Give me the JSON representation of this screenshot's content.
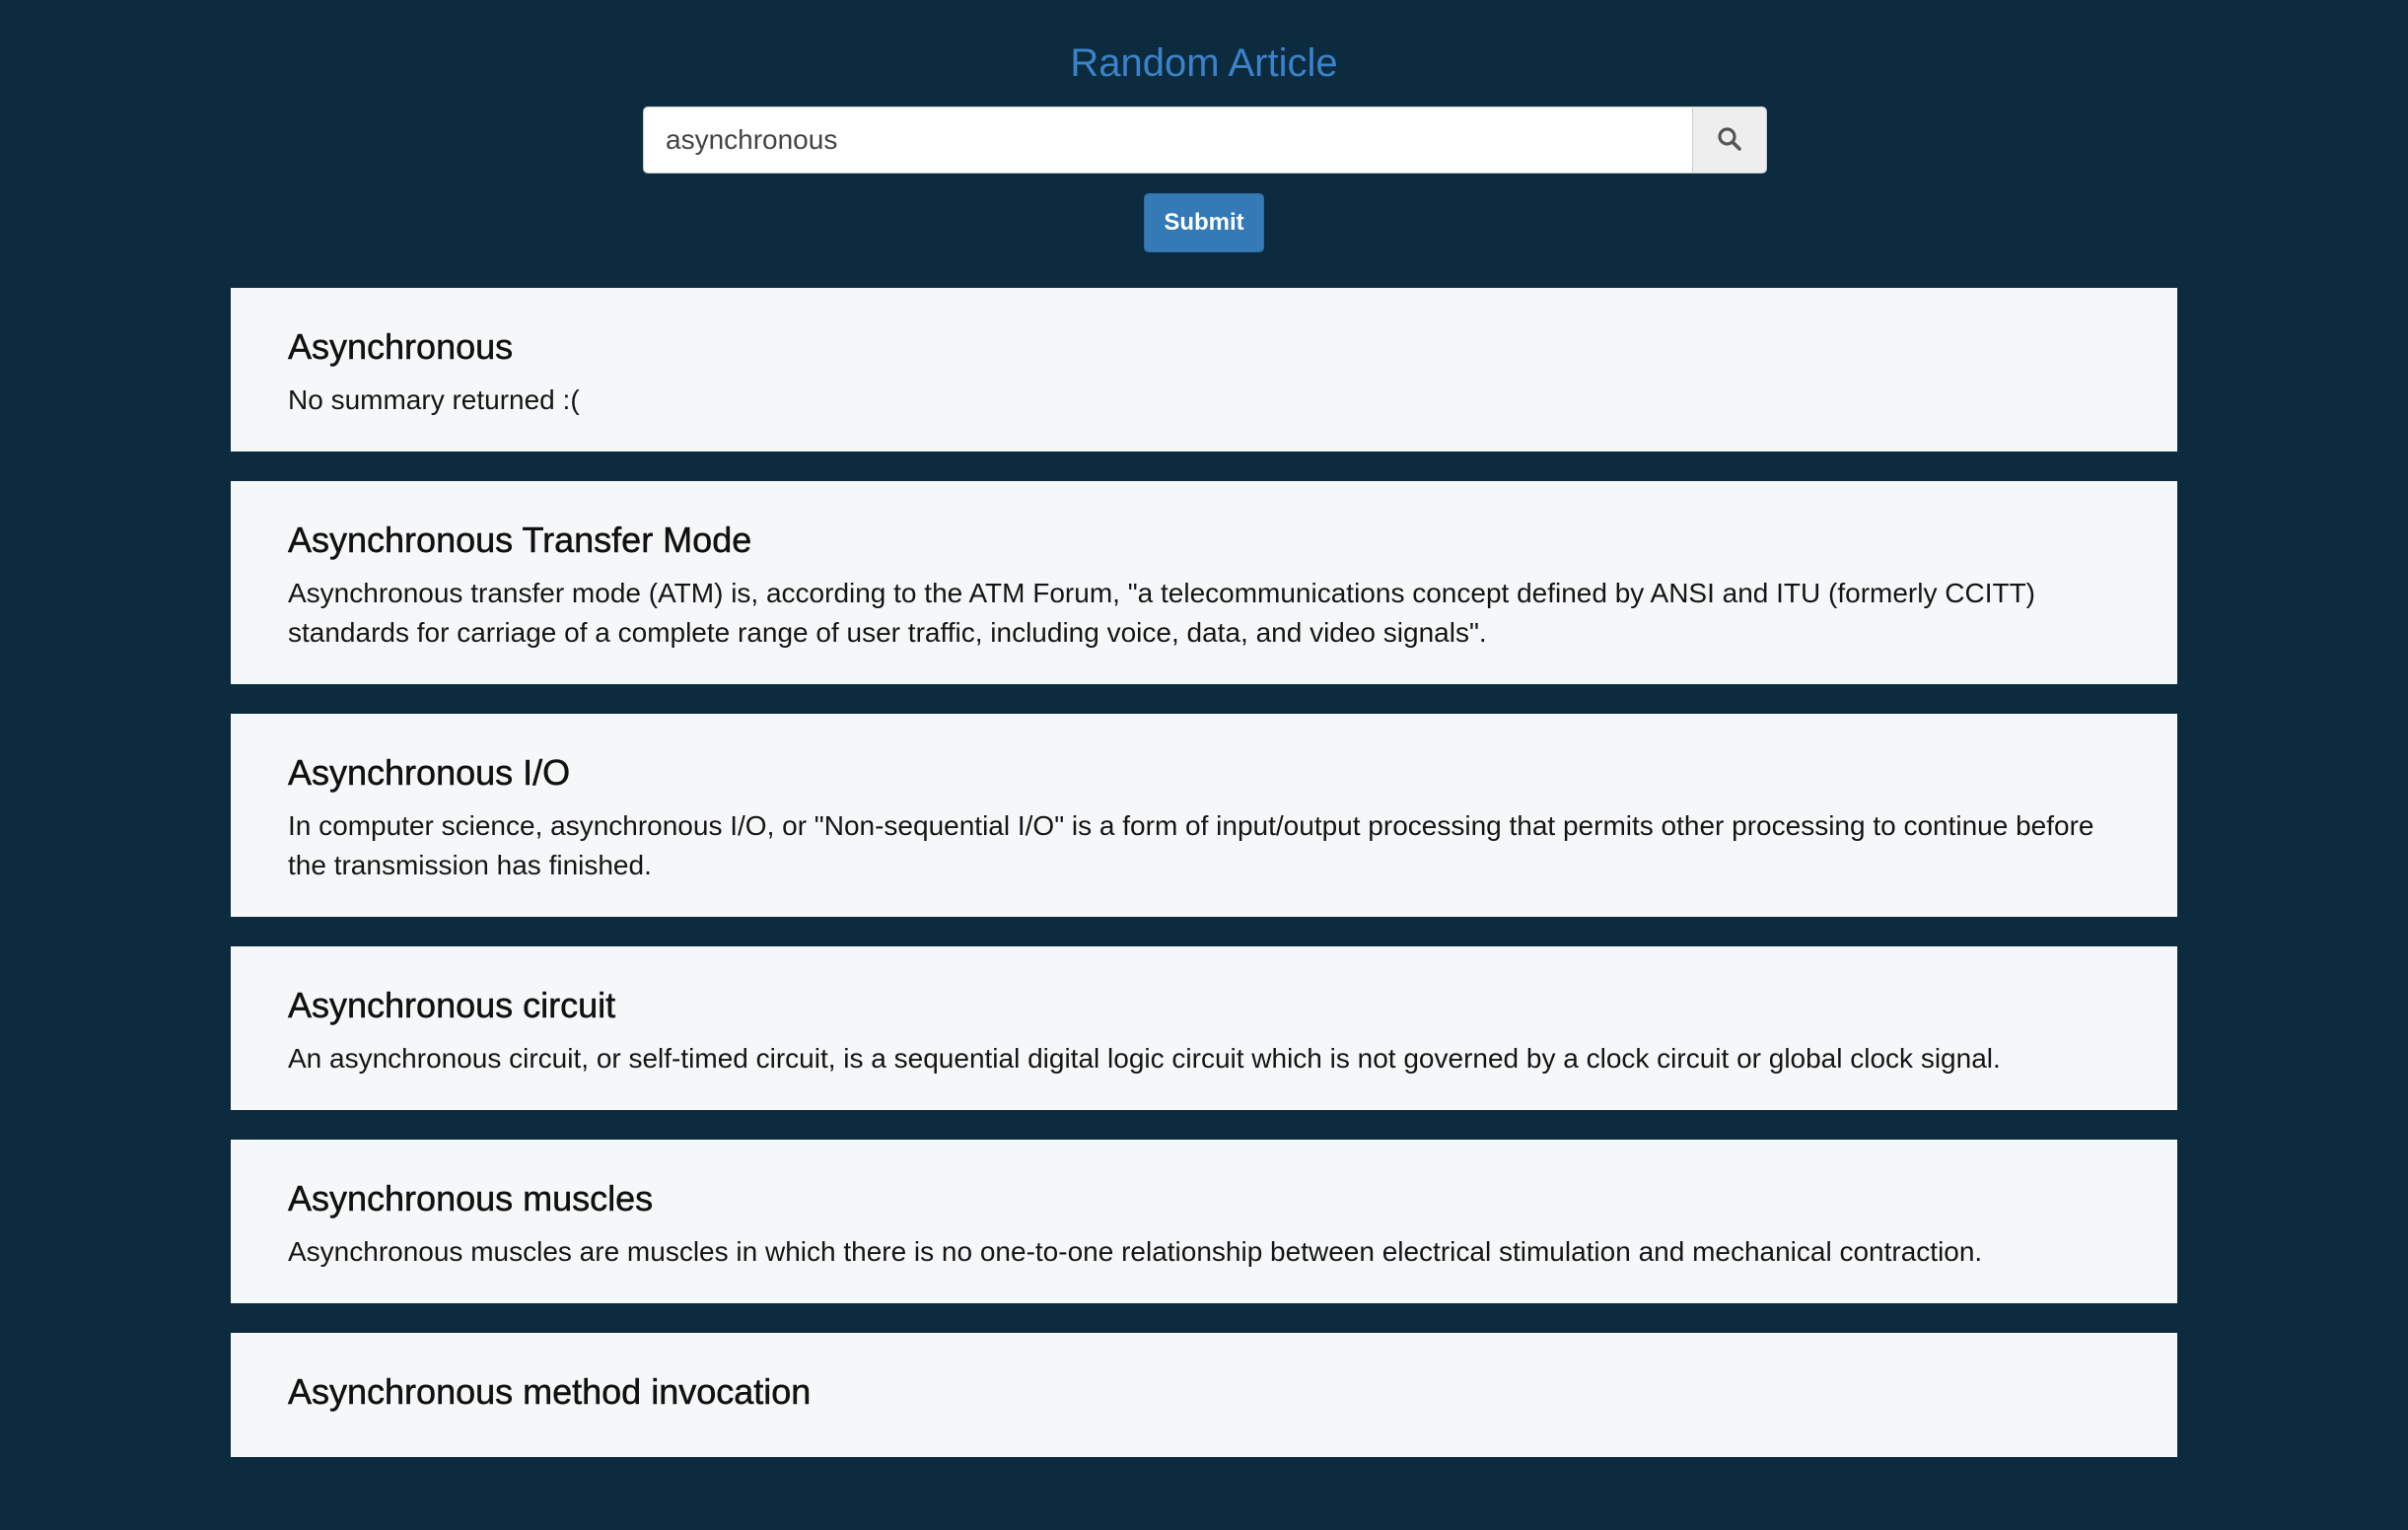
{
  "header": {
    "title": "Random Article"
  },
  "search": {
    "value": "asynchronous",
    "search_icon": "search-icon"
  },
  "submit": {
    "label": "Submit"
  },
  "results": [
    {
      "title": "Asynchronous",
      "summary": "No summary returned :("
    },
    {
      "title": "Asynchronous Transfer Mode",
      "summary": "Asynchronous transfer mode (ATM) is, according to the ATM Forum, \"a telecommunications concept defined by ANSI and ITU (formerly CCITT) standards for carriage of a complete range of user traffic, including voice, data, and video signals\"."
    },
    {
      "title": "Asynchronous I/O",
      "summary": "In computer science, asynchronous I/O, or \"Non-sequential I/O\" is a form of input/output processing that permits other processing to continue before the transmission has finished."
    },
    {
      "title": "Asynchronous circuit",
      "summary": "An asynchronous circuit, or self-timed circuit, is a sequential digital logic circuit which is not governed by a clock circuit or global clock signal."
    },
    {
      "title": "Asynchronous muscles",
      "summary": "Asynchronous muscles are muscles in which there is no one-to-one relationship between electrical stimulation and mechanical contraction."
    },
    {
      "title": "Asynchronous method invocation",
      "summary": ""
    }
  ],
  "colors": {
    "background": "#0c2b3f",
    "title": "#3a82c9",
    "primary_button": "#337ab7",
    "card": "#f6f7f8"
  }
}
